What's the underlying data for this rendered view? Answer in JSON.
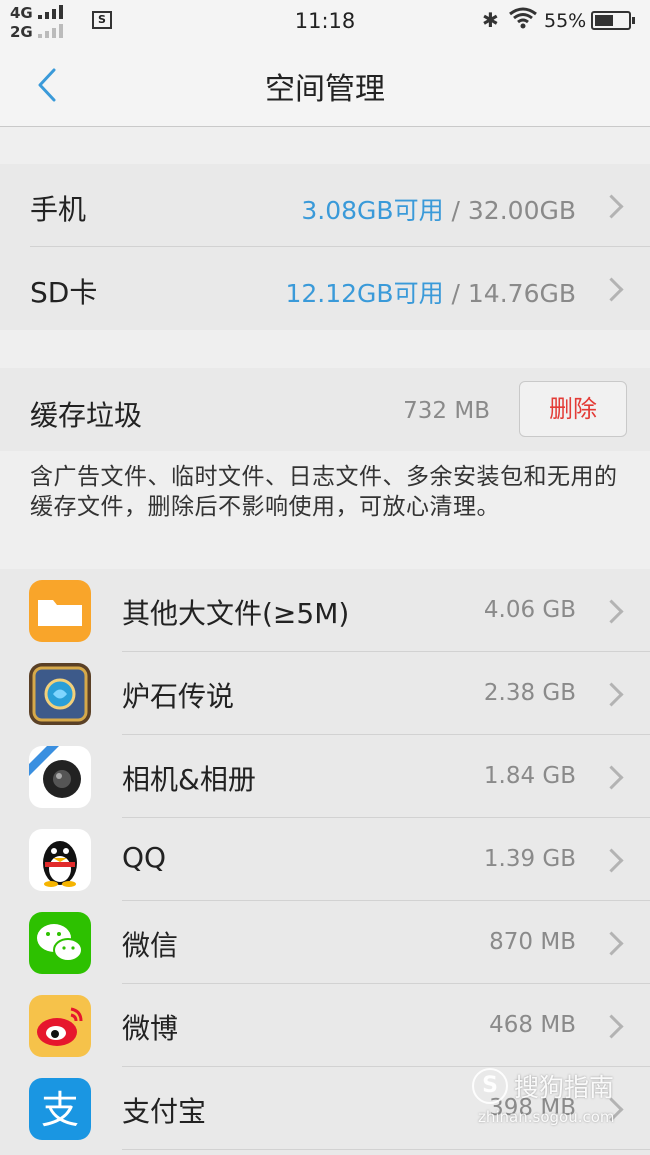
{
  "status_bar": {
    "network_top": "4G",
    "network_bottom": "2G",
    "sim_icon_text": "S",
    "time": "11:18",
    "battery_percent": "55%",
    "battery_level": 0.55
  },
  "header": {
    "title": "空间管理"
  },
  "storage": [
    {
      "label": "手机",
      "available": "3.08GB可用",
      "sep": " / ",
      "total": "32.00GB"
    },
    {
      "label": "SD卡",
      "available": "12.12GB可用",
      "sep": " / ",
      "total": "14.76GB"
    }
  ],
  "cache": {
    "label": "缓存垃圾",
    "size": "732 MB",
    "delete_label": "删除",
    "description": "含广告文件、临时文件、日志文件、多余安装包和无用的缓存文件，删除后不影响使用，可放心清理。"
  },
  "apps": [
    {
      "name": "其他大文件(≥5M)",
      "size": "4.06 GB",
      "icon": "folder-icon",
      "color": "#f9a52a"
    },
    {
      "name": "炉石传说",
      "size": "2.38 GB",
      "icon": "hearthstone-icon",
      "color": "#3d5a8a"
    },
    {
      "name": "相机&相册",
      "size": "1.84 GB",
      "icon": "camera-icon",
      "color": "#ffffff"
    },
    {
      "name": "QQ",
      "size": "1.39 GB",
      "icon": "qq-penguin-icon",
      "color": "#ffffff"
    },
    {
      "name": "微信",
      "size": "870 MB",
      "icon": "wechat-icon",
      "color": "#2dc100"
    },
    {
      "name": "微博",
      "size": "468 MB",
      "icon": "weibo-icon",
      "color": "#f6c24a"
    },
    {
      "name": "支付宝",
      "size": "398 MB",
      "icon": "alipay-icon",
      "color": "#1a96e2"
    }
  ],
  "watermark": {
    "main": "搜狗指南",
    "sub": "zhinan.sogou.com"
  },
  "colors": {
    "accent_blue": "#3a9ad9",
    "delete_red": "#e33b36"
  }
}
